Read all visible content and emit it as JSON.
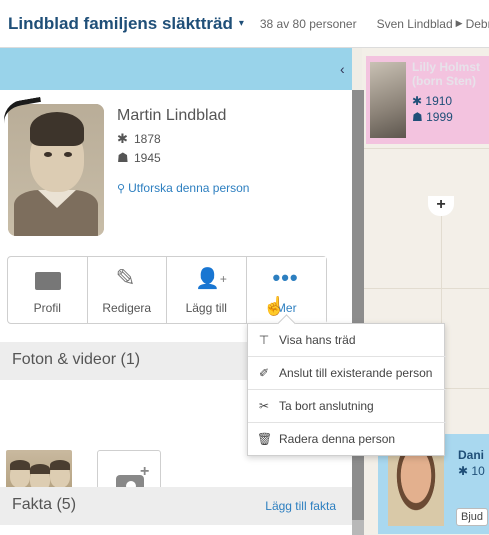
{
  "topbar": {
    "tree_title": "Lindblad familjens släktträd",
    "caret": "▾",
    "count": "38 av 80 personer",
    "crumb_person": "Sven Lindblad",
    "crumb_arrow": "▶",
    "crumb_next": "Debr"
  },
  "panel": {
    "collapse": "‹",
    "person": {
      "name": "Martin Lindblad",
      "birth_icon": "✱",
      "birth": "1878",
      "death_icon": "☗",
      "death": "1945",
      "explore_icon": "⚲",
      "explore": "Utforska denna person"
    },
    "actions": [
      {
        "label": "Profil",
        "icon": "profile-card-icon"
      },
      {
        "label": "Redigera",
        "icon": "pencil-icon"
      },
      {
        "label": "Lägg till",
        "icon": "add-person-icon"
      },
      {
        "label": "Mer",
        "icon": "more-dots-icon"
      }
    ],
    "pencil_glyph": "✎",
    "person_glyph": "👤",
    "plus_glyph": "+",
    "dots_glyph": "•••",
    "cursor_glyph": "☝",
    "photos_section": "Foton & videor (1)",
    "facts_section": "Fakta (5)",
    "facts_link": "Lägg till fakta"
  },
  "menu": {
    "items": [
      {
        "icon": "tree-icon",
        "glyph": "⊤",
        "label": "Visa hans träd"
      },
      {
        "icon": "connect-icon",
        "glyph": "✐",
        "label": "Anslut till existerande person"
      },
      {
        "icon": "disconnect-icon",
        "glyph": "✂",
        "label": "Ta bort anslutning"
      },
      {
        "icon": "trash-icon",
        "glyph": "🗑",
        "label": "Radera denna person"
      }
    ]
  },
  "tree": {
    "lilly_name_1": "Lilly Holmst",
    "lilly_name_2": "(born Sten)",
    "lilly_birth": "1910",
    "lilly_death": "1999",
    "add_glyph": "+",
    "dani_name": "Dani",
    "dani_birth": "10",
    "invite": "Bjud"
  },
  "colors": {
    "accent": "#2d7fc0",
    "header_blue": "#99d3ea",
    "female_card": "#f3c3df",
    "male_card": "#a9d8ef"
  }
}
